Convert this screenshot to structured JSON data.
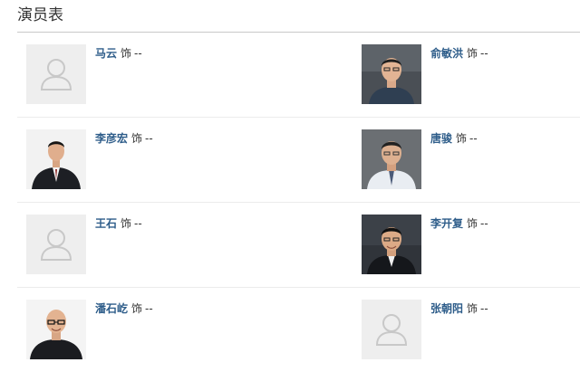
{
  "section": {
    "title": "演员表"
  },
  "cast": [
    {
      "name": "马云",
      "as": "饰",
      "role": "--",
      "photo": "placeholder-icon"
    },
    {
      "name": "俞敏洪",
      "as": "饰",
      "role": "--",
      "photo": "portrait-photo"
    },
    {
      "name": "李彦宏",
      "as": "饰",
      "role": "--",
      "photo": "portrait-photo"
    },
    {
      "name": "唐骏",
      "as": "饰",
      "role": "--",
      "photo": "portrait-photo"
    },
    {
      "name": "王石",
      "as": "饰",
      "role": "--",
      "photo": "placeholder-icon"
    },
    {
      "name": "李开复",
      "as": "饰",
      "role": "--",
      "photo": "portrait-photo"
    },
    {
      "name": "潘石屹",
      "as": "饰",
      "role": "--",
      "photo": "portrait-photo"
    },
    {
      "name": "张朝阳",
      "as": "饰",
      "role": "--",
      "photo": "placeholder-icon"
    }
  ],
  "colors": {
    "actor_link": "#2e5d8a",
    "placeholder_bg": "#eeeeee",
    "placeholder_icon": "#c8c8c8"
  }
}
